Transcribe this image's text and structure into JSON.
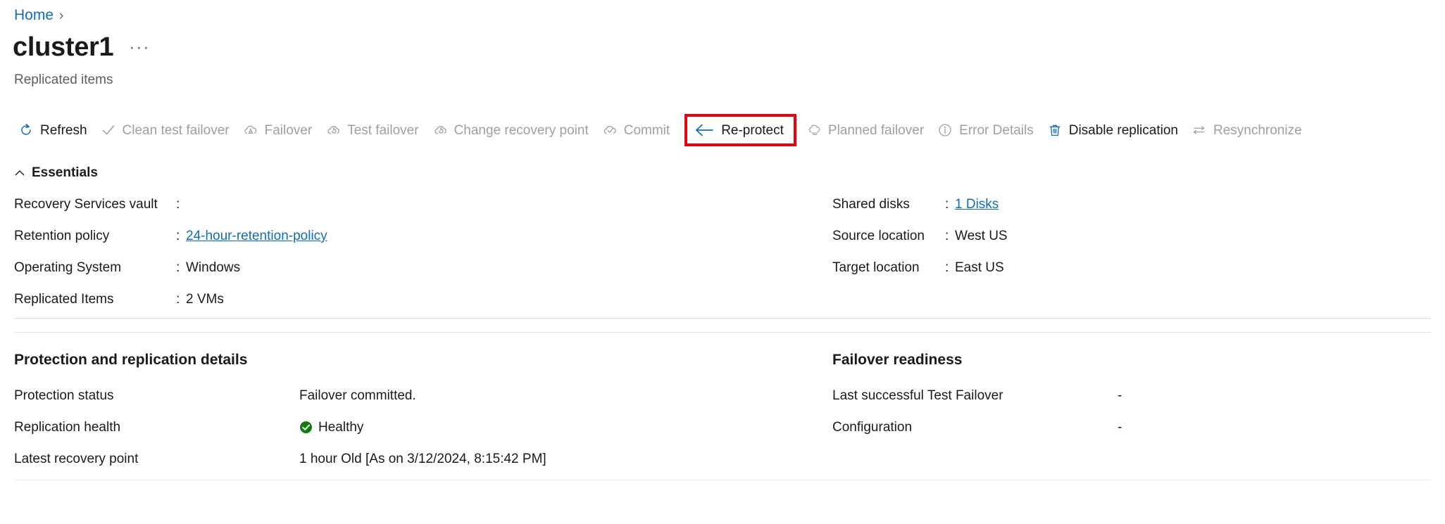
{
  "breadcrumb": {
    "home_label": "Home",
    "separator": "›"
  },
  "header": {
    "title": "cluster1",
    "ellipsis": "···",
    "subtitle": "Replicated items"
  },
  "colors": {
    "link": "#0f6cbd",
    "highlight_border": "#e8000d",
    "healthy": "#107c10",
    "disabled_text": "#a19f9d",
    "primary_text": "#1b1a19"
  },
  "command_bar": {
    "items": [
      {
        "label": "Refresh",
        "icon": "refresh-icon",
        "enabled": true,
        "highlighted": false
      },
      {
        "label": "Clean test failover",
        "icon": "checkmark-icon",
        "enabled": false,
        "highlighted": false
      },
      {
        "label": "Failover",
        "icon": "cloud-failover-icon",
        "enabled": false,
        "highlighted": false
      },
      {
        "label": "Test failover",
        "icon": "cloud-test-failover-icon",
        "enabled": false,
        "highlighted": false
      },
      {
        "label": "Change recovery point",
        "icon": "cloud-recovery-point-icon",
        "enabled": false,
        "highlighted": false
      },
      {
        "label": "Commit",
        "icon": "cloud-check-icon",
        "enabled": false,
        "highlighted": false
      },
      {
        "label": "Re-protect",
        "icon": "arrow-left-icon",
        "enabled": true,
        "highlighted": true
      },
      {
        "label": "Planned failover",
        "icon": "cloud-planned-failover-icon",
        "enabled": false,
        "highlighted": false
      },
      {
        "label": "Error Details",
        "icon": "info-icon",
        "enabled": false,
        "highlighted": false
      },
      {
        "label": "Disable replication",
        "icon": "trash-icon",
        "enabled": true,
        "highlighted": false
      },
      {
        "label": "Resynchronize",
        "icon": "resync-icon",
        "enabled": false,
        "highlighted": false
      }
    ]
  },
  "essentials": {
    "heading": "Essentials",
    "collapse_icon": "chevron-up-icon",
    "left_rows": [
      {
        "key": "Recovery Services vault",
        "colon": ":",
        "value": "",
        "is_link": false
      },
      {
        "key": "Retention policy",
        "colon": ":",
        "value": "24-hour-retention-policy",
        "is_link": true
      },
      {
        "key": "Operating System",
        "colon": ":",
        "value": "Windows",
        "is_link": false
      },
      {
        "key": "Replicated Items",
        "colon": ":",
        "value": "2 VMs",
        "is_link": false
      }
    ],
    "right_rows": [
      {
        "key": "Shared disks",
        "colon": ":",
        "value": "1 Disks",
        "is_link": true
      },
      {
        "key": "Source location",
        "colon": ":",
        "value": "West US",
        "is_link": false
      },
      {
        "key": "Target location",
        "colon": ":",
        "value": "East US",
        "is_link": false
      }
    ]
  },
  "protection_section": {
    "title": "Protection and replication details",
    "rows": [
      {
        "key": "Protection status",
        "value": "Failover committed.",
        "status_icon": ""
      },
      {
        "key": "Replication health",
        "value": "Healthy",
        "status_icon": "healthy-check-icon"
      },
      {
        "key": "Latest recovery point",
        "value": "1 hour Old [As on 3/12/2024, 8:15:42 PM]",
        "status_icon": ""
      }
    ]
  },
  "failover_section": {
    "title": "Failover readiness",
    "rows": [
      {
        "key": "Last successful Test Failover",
        "value": "-"
      },
      {
        "key": "Configuration",
        "value": "-"
      }
    ]
  }
}
